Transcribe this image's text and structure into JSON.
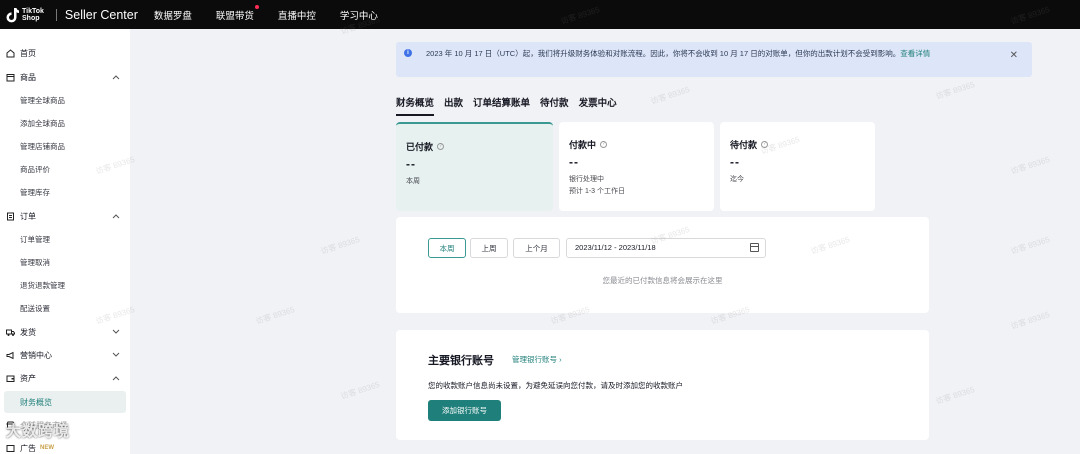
{
  "topbar": {
    "logo_line1": "TikTok",
    "logo_line2": "Shop",
    "app_title": "Seller Center",
    "nav": [
      "数据罗盘",
      "联盟带货",
      "直播中控",
      "学习中心"
    ]
  },
  "sidebar": {
    "home": "首页",
    "products": "商品",
    "product_items": [
      "管理全球商品",
      "添加全球商品",
      "管理店铺商品",
      "商品评价",
      "管理库存"
    ],
    "orders": "订单",
    "order_items": [
      "订单管理",
      "管理取消",
      "退货退款管理",
      "配送设置"
    ],
    "shipping": "发货",
    "marketing": "营销中心",
    "assets": "资产",
    "asset_active": "财务概览",
    "partial": "全球服务市场",
    "ads": "广告",
    "new_badge": "NEW"
  },
  "banner": {
    "text": "2023 年 10 月 17 日（UTC）起，我们将升级财务体验和对账流程。因此，你将不会收到 10 月 17 日的对账单，但你的出款计划不会受到影响。",
    "link": "查看详情"
  },
  "tabs": [
    "财务概览",
    "出款",
    "订单结算账单",
    "待付款",
    "发票中心"
  ],
  "cards": [
    {
      "title": "已付款",
      "value": "--",
      "sub1": "本周",
      "sub2": ""
    },
    {
      "title": "付款中",
      "value": "--",
      "sub1": "银行处理中",
      "sub2": "预计 1-3 个工作日"
    },
    {
      "title": "待付款",
      "value": "--",
      "sub1": "迄今",
      "sub2": ""
    }
  ],
  "filter": {
    "ranges": [
      "本周",
      "上周",
      "上个月"
    ],
    "date_range": "2023/11/12 - 2023/11/18",
    "empty_message": "您最近的已付款信息将会展示在这里"
  },
  "bank": {
    "title": "主要银行账号",
    "manage_link": "管理银行账号",
    "description": "您的收款账户信息尚未设置，为避免延误向您付款，请及时添加您的收款账户",
    "add_button": "添加银行账号"
  },
  "watermark": "访客 89365",
  "corner_watermark": "大数跨境"
}
